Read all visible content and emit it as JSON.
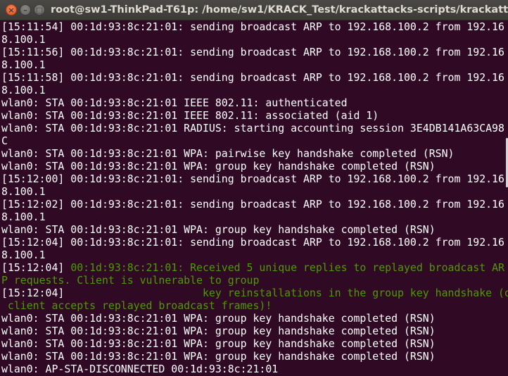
{
  "window": {
    "title": "root@sw1-ThinkPad-T61p: /home/sw1/KRACK_Test/krackattacks-scripts/krackattack",
    "controls": {
      "close": "×",
      "minimize": "–",
      "maximize": "□"
    }
  },
  "colors": {
    "background": "#300a24",
    "text": "#ffffff",
    "highlight": "#4e9a06"
  },
  "terminal": {
    "lines": [
      [
        {
          "t": "[15:11:54] 00:1d:93:8c:21:01: sending broadcast ARP to 192.168.100.2 from 192.16"
        }
      ],
      [
        {
          "t": "8.100.1"
        }
      ],
      [
        {
          "t": "[15:11:56] 00:1d:93:8c:21:01: sending broadcast ARP to 192.168.100.2 from 192.16"
        }
      ],
      [
        {
          "t": "8.100.1"
        }
      ],
      [
        {
          "t": "[15:11:58] 00:1d:93:8c:21:01: sending broadcast ARP to 192.168.100.2 from 192.16"
        }
      ],
      [
        {
          "t": "8.100.1"
        }
      ],
      [
        {
          "t": "wlan0: STA 00:1d:93:8c:21:01 IEEE 802.11: authenticated"
        }
      ],
      [
        {
          "t": "wlan0: STA 00:1d:93:8c:21:01 IEEE 802.11: associated (aid 1)"
        }
      ],
      [
        {
          "t": "wlan0: STA 00:1d:93:8c:21:01 RADIUS: starting accounting session 3E4DB141A63CA98"
        }
      ],
      [
        {
          "t": "C"
        }
      ],
      [
        {
          "t": "wlan0: STA 00:1d:93:8c:21:01 WPA: pairwise key handshake completed (RSN)"
        }
      ],
      [
        {
          "t": "wlan0: STA 00:1d:93:8c:21:01 WPA: group key handshake completed (RSN)"
        }
      ],
      [
        {
          "t": "[15:12:00] 00:1d:93:8c:21:01: sending broadcast ARP to 192.168.100.2 from 192.16"
        }
      ],
      [
        {
          "t": "8.100.1"
        }
      ],
      [
        {
          "t": "[15:12:02] 00:1d:93:8c:21:01: sending broadcast ARP to 192.168.100.2 from 192.16"
        }
      ],
      [
        {
          "t": "8.100.1"
        }
      ],
      [
        {
          "t": "wlan0: STA 00:1d:93:8c:21:01 WPA: group key handshake completed (RSN)"
        }
      ],
      [
        {
          "t": "[15:12:04] 00:1d:93:8c:21:01: sending broadcast ARP to 192.168.100.2 from 192.16"
        }
      ],
      [
        {
          "t": "8.100.1"
        }
      ],
      [
        {
          "t": "[15:12:04] "
        },
        {
          "t": "00:1d:93:8c:21:01: Received 5 unique replies to replayed broadcast AR",
          "c": "green"
        }
      ],
      [
        {
          "t": "P requests. Client is vulnerable to group",
          "c": "green"
        }
      ],
      [
        {
          "t": "[15:12:04]"
        },
        {
          "t": "                      key reinstallations in the group key handshake (or",
          "c": "green"
        }
      ],
      [
        {
          "t": " client accepts replayed broadcast frames)!",
          "c": "green"
        }
      ],
      [
        {
          "t": "wlan0: STA 00:1d:93:8c:21:01 WPA: group key handshake completed (RSN)"
        }
      ],
      [
        {
          "t": "wlan0: STA 00:1d:93:8c:21:01 WPA: group key handshake completed (RSN)"
        }
      ],
      [
        {
          "t": "wlan0: STA 00:1d:93:8c:21:01 WPA: group key handshake completed (RSN)"
        }
      ],
      [
        {
          "t": "wlan0: STA 00:1d:93:8c:21:01 WPA: group key handshake completed (RSN)"
        }
      ],
      [
        {
          "t": "wlan0: AP-STA-DISCONNECTED 00:1d:93:8c:21:01"
        }
      ]
    ]
  }
}
